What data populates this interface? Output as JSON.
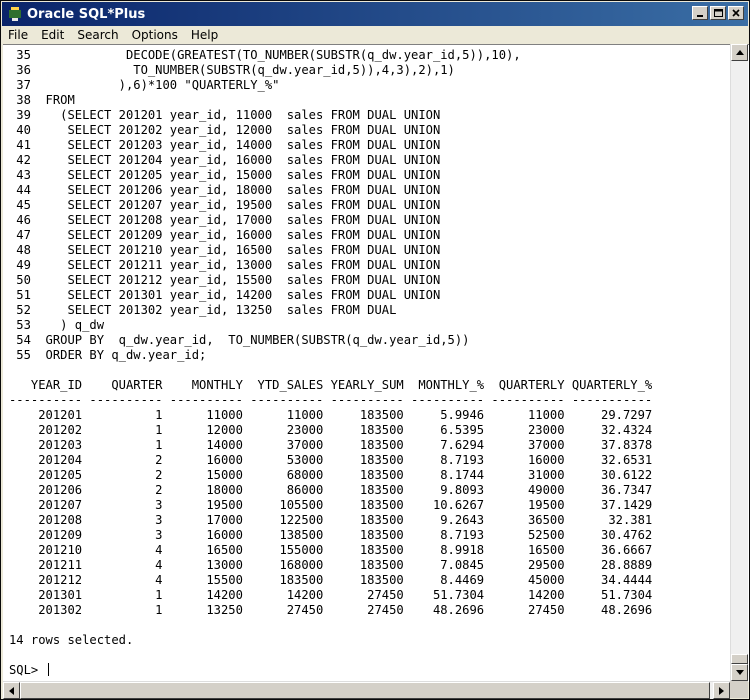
{
  "window": {
    "title": "Oracle SQL*Plus",
    "icon": "sqlplus-app-icon",
    "controls": [
      "minimize-icon",
      "maximize-icon",
      "close-icon"
    ]
  },
  "menu": [
    "File",
    "Edit",
    "Search",
    "Options",
    "Help"
  ],
  "console": {
    "lines": [
      " 35             DECODE(GREATEST(TO_NUMBER(SUBSTR(q_dw.year_id,5)),10),",
      " 36              TO_NUMBER(SUBSTR(q_dw.year_id,5)),4,3),2),1)",
      " 37            ),6)*100 \"QUARTERLY_%\"",
      " 38  FROM",
      " 39    (SELECT 201201 year_id, 11000  sales FROM DUAL UNION",
      " 40     SELECT 201202 year_id, 12000  sales FROM DUAL UNION",
      " 41     SELECT 201203 year_id, 14000  sales FROM DUAL UNION",
      " 42     SELECT 201204 year_id, 16000  sales FROM DUAL UNION",
      " 43     SELECT 201205 year_id, 15000  sales FROM DUAL UNION",
      " 44     SELECT 201206 year_id, 18000  sales FROM DUAL UNION",
      " 45     SELECT 201207 year_id, 19500  sales FROM DUAL UNION",
      " 46     SELECT 201208 year_id, 17000  sales FROM DUAL UNION",
      " 47     SELECT 201209 year_id, 16000  sales FROM DUAL UNION",
      " 48     SELECT 201210 year_id, 16500  sales FROM DUAL UNION",
      " 49     SELECT 201211 year_id, 13000  sales FROM DUAL UNION",
      " 50     SELECT 201212 year_id, 15500  sales FROM DUAL UNION",
      " 51     SELECT 201301 year_id, 14200  sales FROM DUAL UNION",
      " 52     SELECT 201302 year_id, 13250  sales FROM DUAL",
      " 53    ) q_dw",
      " 54  GROUP BY  q_dw.year_id,  TO_NUMBER(SUBSTR(q_dw.year_id,5))",
      " 55  ORDER BY q_dw.year_id;",
      "",
      "   YEAR_ID    QUARTER    MONTHLY  YTD_SALES YEARLY_SUM  MONTHLY_%  QUARTERLY QUARTERLY_%",
      "---------- ---------- ---------- ---------- ---------- ---------- ---------- -----------",
      "    201201          1      11000      11000     183500     5.9946      11000     29.7297",
      "    201202          1      12000      23000     183500     6.5395      23000     32.4324",
      "    201203          1      14000      37000     183500     7.6294      37000     37.8378",
      "    201204          2      16000      53000     183500     8.7193      16000     32.6531",
      "    201205          2      15000      68000     183500     8.1744      31000     30.6122",
      "    201206          2      18000      86000     183500     9.8093      49000     36.7347",
      "    201207          3      19500     105500     183500    10.6267      19500     37.1429",
      "    201208          3      17000     122500     183500     9.2643      36500      32.381",
      "    201209          3      16000     138500     183500     8.7193      52500     30.4762",
      "    201210          4      16500     155000     183500     8.9918      16500     36.6667",
      "    201211          4      13000     168000     183500     7.0845      29500     28.8889",
      "    201212          4      15500     183500     183500     8.4469      45000     34.4444",
      "    201301          1      14200      14200      27450    51.7304      14200     51.7304",
      "    201302          1      13250      27450      27450    48.2696      27450     48.2696",
      "",
      "14 rows selected.",
      ""
    ],
    "prompt": "SQL> "
  },
  "scrollbars": {
    "vertical": [
      "scroll-up-arrow-icon",
      "scroll-down-arrow-icon"
    ],
    "horizontal": [
      "scroll-left-arrow-icon",
      "scroll-right-arrow-icon"
    ]
  }
}
